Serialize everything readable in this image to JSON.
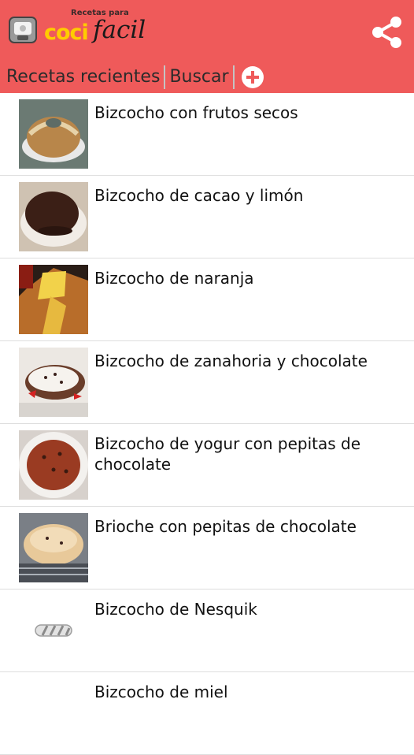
{
  "app": {
    "logo_small": "Recetas para",
    "logo_coci": "coci",
    "logo_facil": "facil"
  },
  "tabs": [
    {
      "label": "Recetas recientes"
    },
    {
      "label": "Buscar"
    }
  ],
  "recipes": [
    {
      "title": "Bizcocho con frutos secos"
    },
    {
      "title": "Bizcocho de cacao y limón"
    },
    {
      "title": "Bizcocho de naranja"
    },
    {
      "title": "Bizcocho de zanahoria y chocolate"
    },
    {
      "title": "Bizcocho de yogur con pepitas de chocolate"
    },
    {
      "title": "Brioche con pepitas de chocolate"
    },
    {
      "title": "Bizcocho de Nesquik"
    },
    {
      "title": "Bizcocho de miel"
    }
  ],
  "colors": {
    "appbar": "#ef5a5a",
    "logo_accent": "#ffcc00"
  },
  "icons": [
    "pot-logo-icon",
    "share-icon",
    "add-circle-icon",
    "image-loading-icon"
  ]
}
